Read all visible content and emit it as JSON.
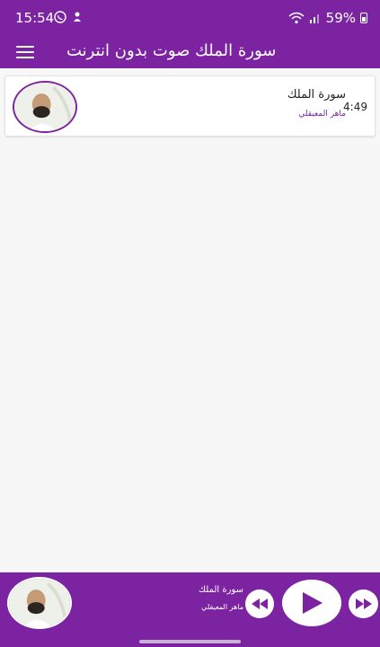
{
  "status_bar": {
    "time": "15:54",
    "battery": "59%",
    "icons": [
      "whatsapp-icon",
      "notification-icon",
      "wifi-icon",
      "signal-icon",
      "battery-icon"
    ]
  },
  "app_bar": {
    "title": "سورة الملك صوت بدون انترنت",
    "menu_icon": "hamburger-menu-icon"
  },
  "track_list": [
    {
      "title": "سورة الملك",
      "artist": "ماهر المعيقلي",
      "duration": "4:49"
    }
  ],
  "player": {
    "title": "سورة الملك",
    "artist": "ماهر المعيقلي",
    "controls": [
      "rewind-icon",
      "play-icon",
      "fast-forward-icon"
    ]
  },
  "colors": {
    "primary": "#7b23a0",
    "background": "#f7f7f7",
    "card": "#ffffff"
  }
}
